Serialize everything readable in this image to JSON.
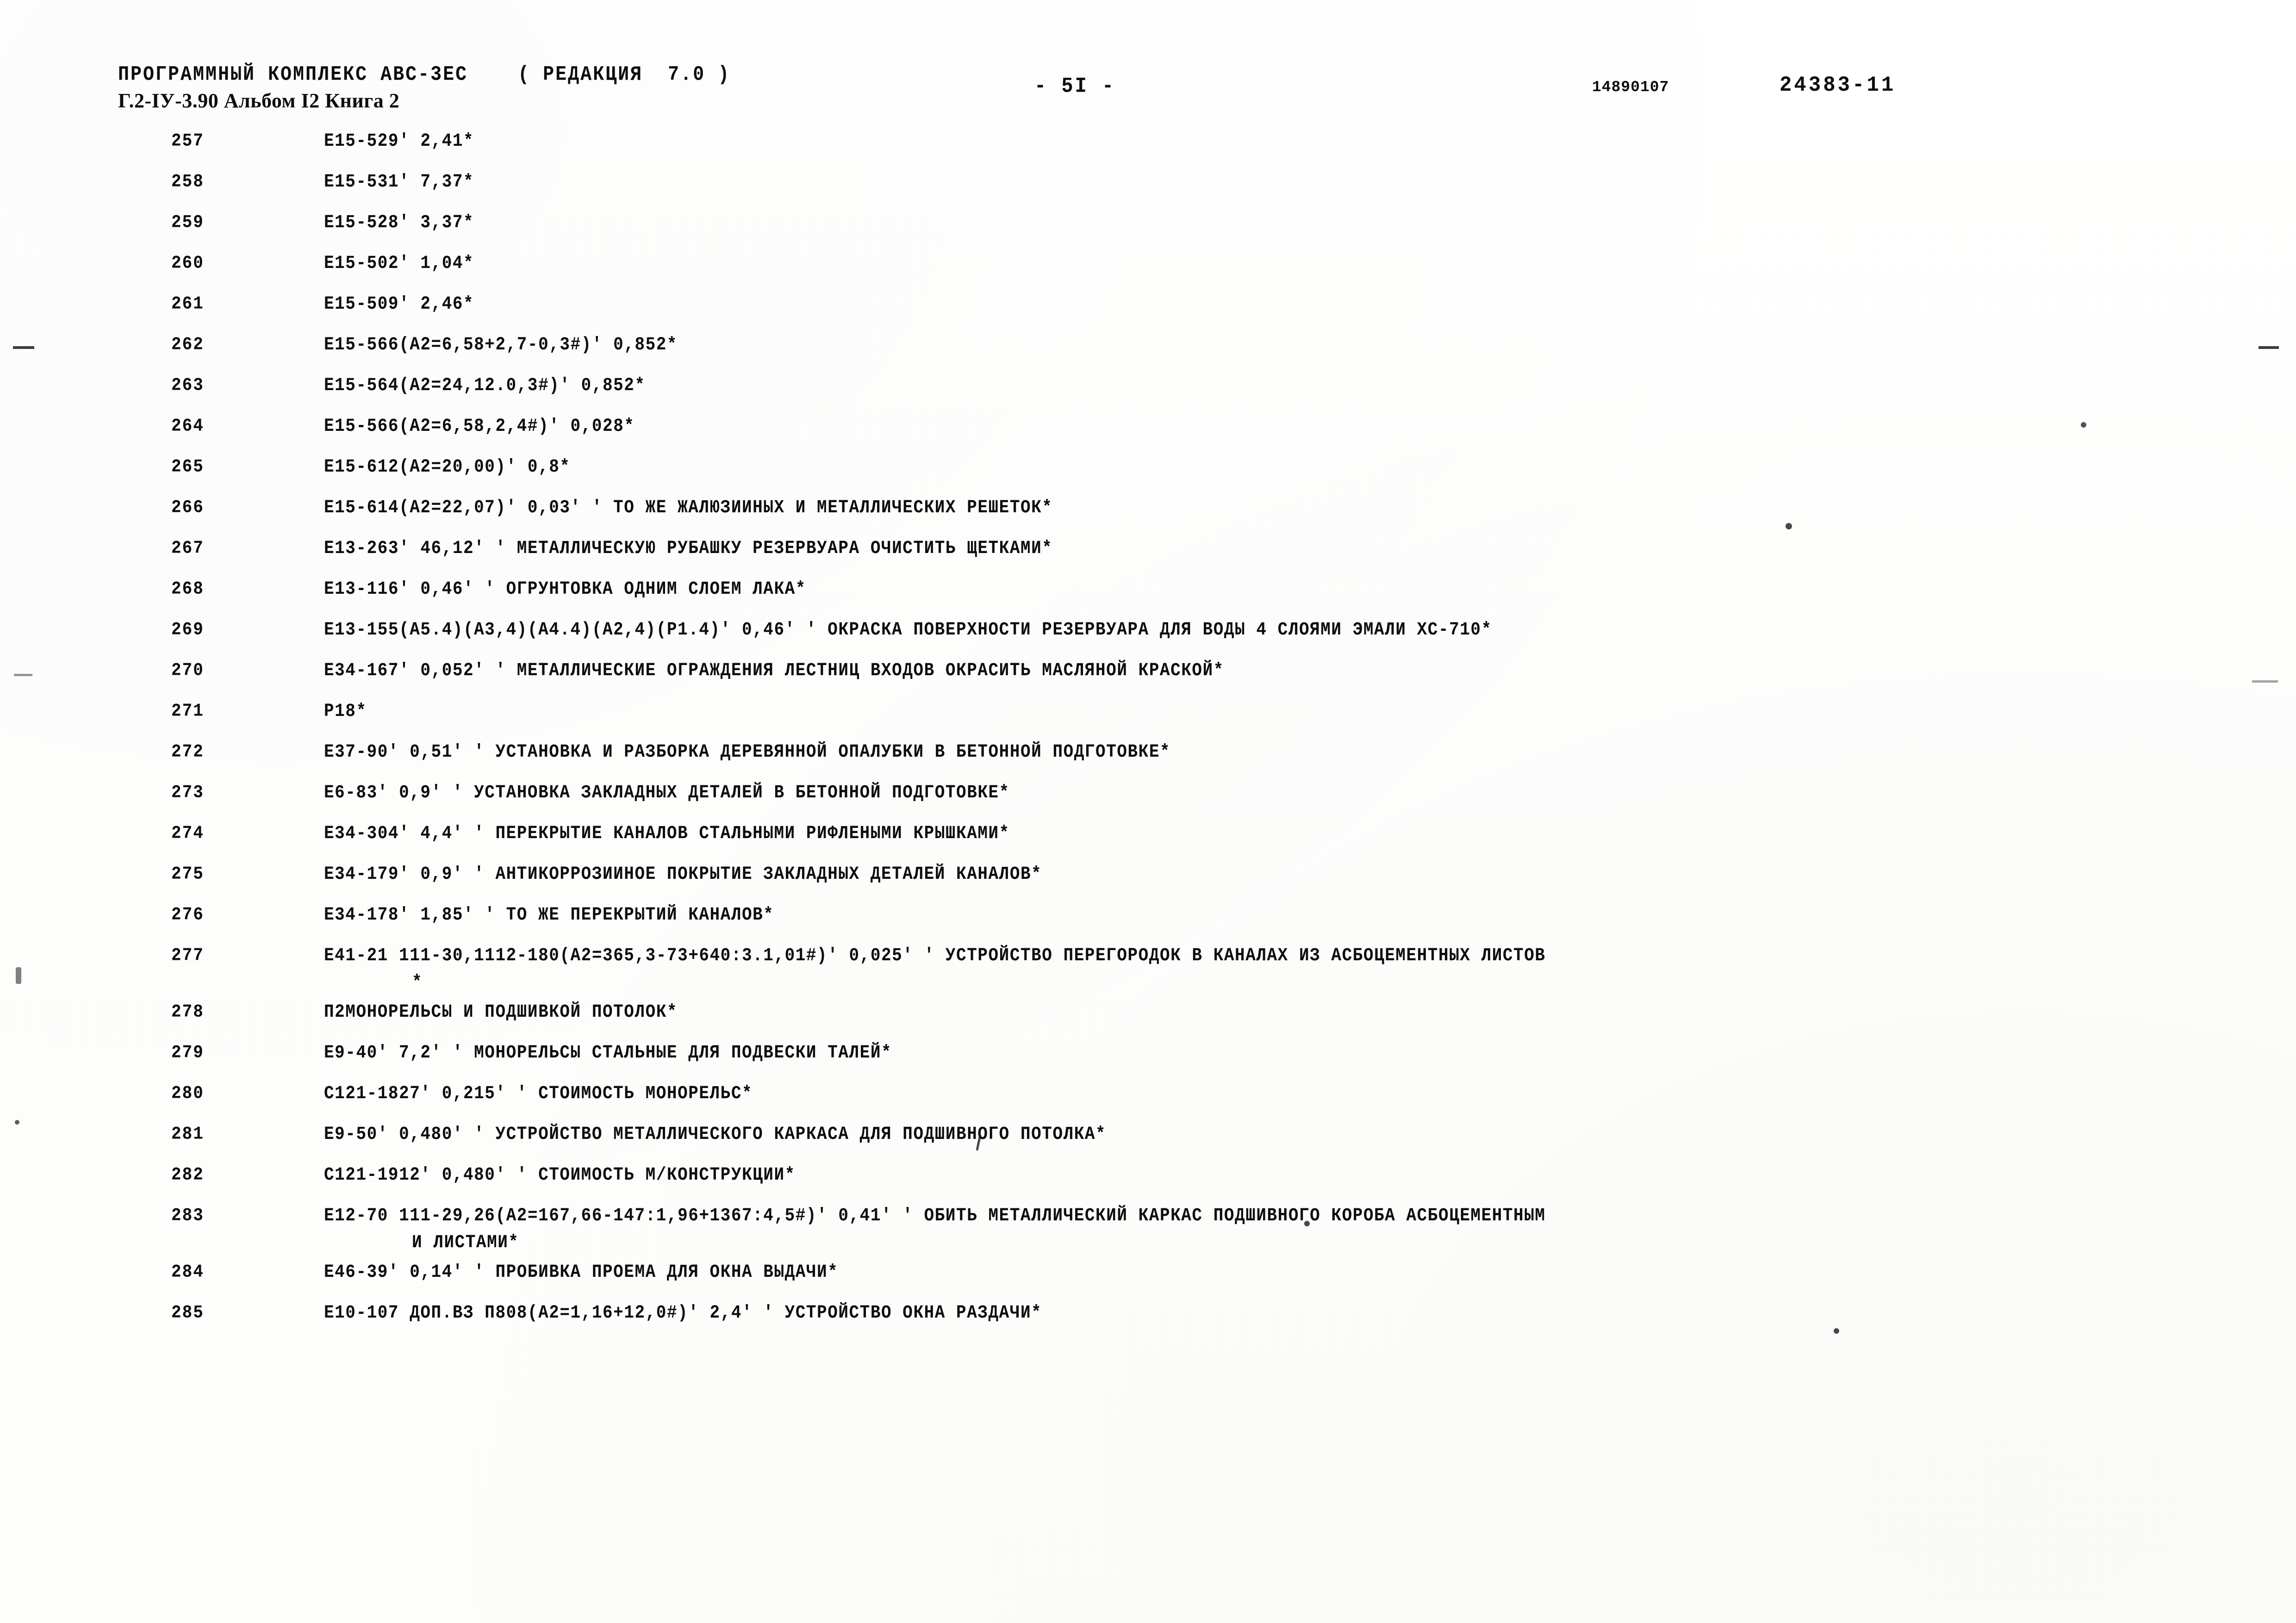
{
  "header": {
    "program_line": "ПРОГРАММНЫЙ КОМПЛЕКС АВС-3ЕС    ( РЕДАКЦИЯ  7.0 )",
    "album_line": "Г.2-IУ-3.90 Альбом I2 Книга 2",
    "page_marker": "- 5I -",
    "doc_code_left": "14890107",
    "doc_code_right": "24383-11"
  },
  "rows": [
    {
      "num": "257",
      "text": "E15-529' 2,41*"
    },
    {
      "num": "258",
      "text": "E15-531' 7,37*"
    },
    {
      "num": "259",
      "text": "E15-528' 3,37*"
    },
    {
      "num": "260",
      "text": "E15-502' 1,04*"
    },
    {
      "num": "261",
      "text": "E15-509' 2,46*"
    },
    {
      "num": "262",
      "text": "E15-566(A2=6,58+2,7-0,3#)' 0,852*"
    },
    {
      "num": "263",
      "text": "E15-564(A2=24,12.0,3#)' 0,852*"
    },
    {
      "num": "264",
      "text": "E15-566(A2=6,58,2,4#)' 0,028*"
    },
    {
      "num": "265",
      "text": "E15-612(A2=20,00)' 0,8*"
    },
    {
      "num": "266",
      "text": "E15-614(A2=22,07)' 0,03' ' ТО ЖЕ ЖАЛЮЗИИНЫХ И МЕТАЛЛИЧЕСКИХ РЕШЕТОК*"
    },
    {
      "num": "267",
      "text": "E13-263' 46,12' ' МЕТАЛЛИЧЕСКУЮ РУБАШКУ РЕЗЕРВУАРА ОЧИСТИТЬ ЩЕТКАМИ*"
    },
    {
      "num": "268",
      "text": "E13-116' 0,46' ' ОГРУНТОВКА ОДНИМ СЛОЕМ ЛАКА*"
    },
    {
      "num": "269",
      "text": "E13-155(A5.4)(A3,4)(A4.4)(A2,4)(P1.4)' 0,46' ' ОКРАСКА ПОВЕРХНОСТИ РЕЗЕРВУАРА ДЛЯ ВОДЫ 4 СЛОЯМИ ЭМАЛИ ХС-710*"
    },
    {
      "num": "270",
      "text": "E34-167' 0,052' ' МЕТАЛЛИЧЕСКИЕ ОГРАЖДЕНИЯ ЛЕСТНИЦ ВХОДОВ ОКРАСИТЬ МАСЛЯНОЙ КРАСКОЙ*"
    },
    {
      "num": "271",
      "text": "P18*"
    },
    {
      "num": "272",
      "text": "E37-90' 0,51' ' УСТАНОВКА И РАЗБОРКА ДЕРЕВЯННОЙ ОПАЛУБКИ В БЕТОННОЙ ПОДГОТОВКЕ*"
    },
    {
      "num": "273",
      "text": "E6-83' 0,9' ' УСТАНОВКА ЗАКЛАДНЫХ ДЕТАЛЕЙ В БЕТОННОЙ ПОДГОТОВКЕ*"
    },
    {
      "num": "274",
      "text": "E34-304' 4,4' ' ПЕРЕКРЫТИЕ КАНАЛОВ СТАЛЬНЫМИ РИФЛЕНЫМИ КРЫШКАМИ*"
    },
    {
      "num": "275",
      "text": "E34-179' 0,9' ' АНТИКОРРОЗИИНОЕ ПОКРЫТИЕ ЗАКЛАДНЫХ ДЕТАЛЕЙ КАНАЛОВ*"
    },
    {
      "num": "276",
      "text": "E34-178' 1,85' ' ТО ЖЕ ПЕРЕКРЫТИЙ КАНАЛОВ*"
    },
    {
      "num": "277",
      "text": "E41-21 111-30,1112-180(A2=365,3-73+640:3.1,01#)' 0,025' ' УСТРОЙСТВО ПЕРЕГОРОДОК В КАНАЛАХ ИЗ АСБОЦЕМЕНТНЫХ ЛИСТОВ",
      "cont": "*"
    },
    {
      "num": "278",
      "text": "П2МОНОРЕЛЬСЫ И ПОДШИВКОЙ ПОТОЛОК*"
    },
    {
      "num": "279",
      "text": "E9-40' 7,2' ' МОНОРЕЛЬСЫ СТАЛЬНЫЕ ДЛЯ ПОДВЕСКИ ТАЛЕЙ*"
    },
    {
      "num": "280",
      "text": "C121-1827' 0,215' ' СТОИМОСТЬ МОНОРЕЛЬС*"
    },
    {
      "num": "281",
      "text": "E9-50' 0,480' ' УСТРОЙСТВО МЕТАЛЛИЧЕСКОГО КАРКАСА ДЛЯ ПОДШИВНОГО ПОТОЛКА*"
    },
    {
      "num": "282",
      "text": "C121-1912' 0,480' ' СТОИМОСТЬ М/КОНСТРУКЦИИ*"
    },
    {
      "num": "283",
      "text": "E12-70 111-29,26(A2=167,66-147:1,96+1367:4,5#)' 0,41' ' ОБИТЬ МЕТАЛЛИЧЕСКИЙ КАРКАС ПОДШИВНОГО КОРОБА АСБОЦЕМЕНТНЫМ",
      "cont": "И ЛИСТАМИ*"
    },
    {
      "num": "284",
      "text": "E46-39' 0,14' ' ПРОБИВКА ПРОЕМА ДЛЯ ОКНА ВЫДАЧИ*"
    },
    {
      "num": "285",
      "text": "E10-107 ДОП.ВЗ П808(A2=1,16+12,0#)' 2,4' ' УСТРОЙСТВО ОКНА РАЗДАЧИ*"
    }
  ]
}
